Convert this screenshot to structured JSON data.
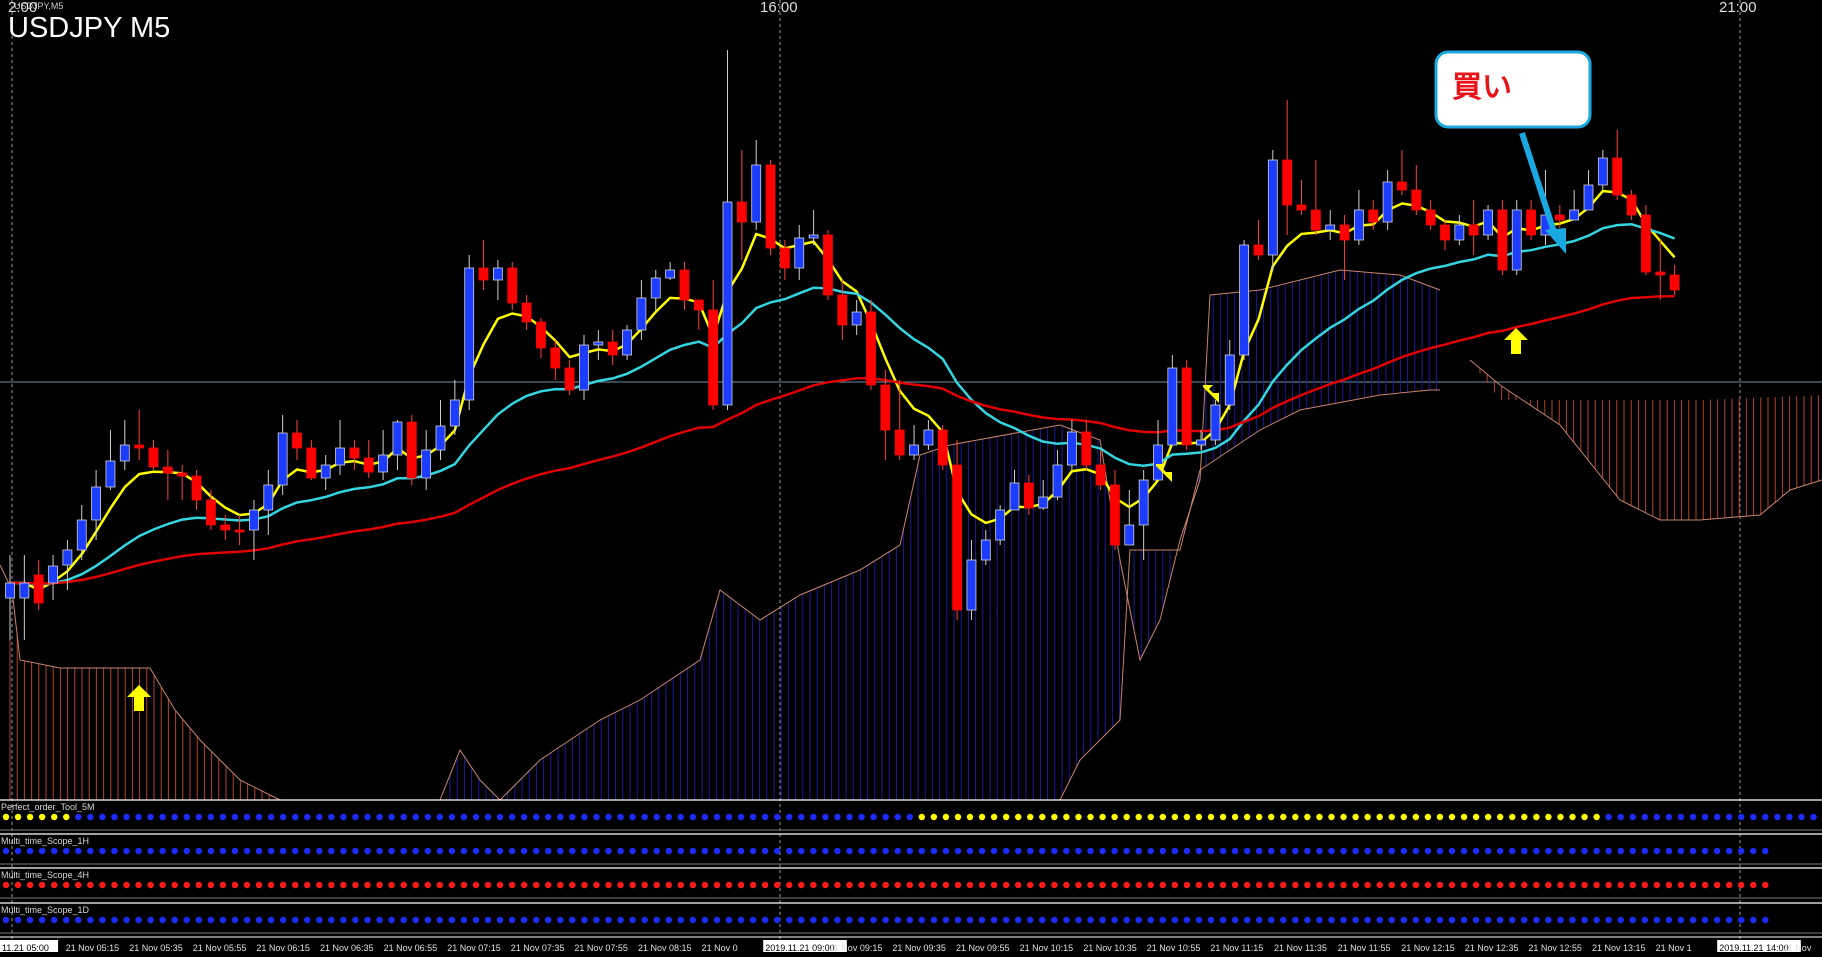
{
  "window": {
    "title": "USDJPY M5",
    "subtitle": "USDJPY,M5"
  },
  "colors": {
    "background": "#000000",
    "bull": "#1c3cff",
    "bear": "#ff0000",
    "ma_fast": "#ffff00",
    "ma_mid": "#33d6e0",
    "ma_slow": "#e00000",
    "cloud_bull": "#1b1b9a",
    "cloud_bear": "#b0452e",
    "dot_yellow": "#ffff00",
    "dot_blue": "#1c2cff",
    "dot_red": "#ff1a1a",
    "arrow_blue": "#1aa8e0"
  },
  "axis": {
    "top_labels": [
      "2:00",
      "16:00",
      "21:00"
    ],
    "x_labels": [
      "11.21 05:00",
      "21 Nov 05:15",
      "21 Nov 05:35",
      "21 Nov 05:55",
      "21 Nov 06:15",
      "21 Nov 06:35",
      "21 Nov 06:55",
      "21 Nov 07:15",
      "21 Nov 07:35",
      "21 Nov 07:55",
      "21 Nov 08:15",
      "21 Nov 0",
      "2019.11.21 09:00",
      "21 Nov 09:15",
      "21 Nov 09:35",
      "21 Nov 09:55",
      "21 Nov 10:15",
      "21 Nov 10:35",
      "21 Nov 10:55",
      "21 Nov 11:15",
      "21 Nov 11:35",
      "21 Nov 11:55",
      "21 Nov 12:15",
      "21 Nov 12:35",
      "21 Nov 12:55",
      "21 Nov 13:15",
      "21 Nov 1",
      "2019.11.21 14:00",
      "21 Nov"
    ]
  },
  "annotation": {
    "label": "買い"
  },
  "indicators": [
    {
      "name": "Perfect_order_Tool_5M",
      "dots": "YYYYYYBBBBBBBBBBBBBBBBBBBBBBBBBBBBBBBBBBBBBBBBBBBBBBBBBBBBBBBBBBBBBBBBBBBBBBYYYYYYYYYYYYYYYYYYYYYYYYYYYYYYYYYYYYYYYYYYYYYYYYYYYYYYYYYBBBBBBBBBBBBBBBBBBBBBBBBB"
    },
    {
      "name": "Multi_time_Scope_1H",
      "dots": "BBBBBBBBBBBBBBBBBBBBBBBBBBBBBBBBBBBBBBBBBBBBBBBBBBBBBBBBBBBBBBBBBBBBBBBBBBBBBBBBBBBBBBBBBBBBBBBBBBBBBBBBBBBBBBBBBBBBBBBBBBBBBBBBBBBBBBBBBBBBBBBBBBB"
    },
    {
      "name": "Multi_time_Scope_4H",
      "dots": "RRRRRRRRRRRRRRRRRRRRRRRRRRRRRRRRRRRRRRRRRRRRRRRRRRRRRRRRRRRRRRRRRRRRRRRRRRRRRRRRRRRRRRRRRRRRRRRRRRRRRRRRRRRRRRRRRRRRRRRRRRRRRRRRRRRRRRRRRRRRRRRRRRR"
    },
    {
      "name": "Multi_time_Scope_1D",
      "dots": "BBBBBBBBBBBBBBBBBBBBBBBBBBBBBBBBBBBBBBBBBBBBBBBBBBBBBBBBBBBBBBBBBBBBBBBBBBBBBBBBBBBBBBBBBBBBBBBBBBBBBBBBBBBBBBBBBBBBBBBBBBBBBBBBBBBBBBBBBBBBBBBBBBB"
    }
  ],
  "chart_data": {
    "type": "candlestick",
    "symbol": "USDJPY",
    "timeframe": "M5",
    "ylim": [
      0,
      800
    ],
    "candles": [
      [
        598,
        583,
        640,
        555
      ],
      [
        598,
        583,
        640,
        555
      ],
      [
        575,
        603,
        610,
        560
      ],
      [
        583,
        566,
        600,
        555
      ],
      [
        565,
        550,
        590,
        540
      ],
      [
        550,
        520,
        560,
        505
      ],
      [
        520,
        487,
        540,
        470
      ],
      [
        487,
        461,
        490,
        430
      ],
      [
        461,
        445,
        470,
        420
      ],
      [
        445,
        448,
        460,
        410
      ],
      [
        448,
        467,
        470,
        440
      ],
      [
        467,
        473,
        500,
        450
      ],
      [
        473,
        476,
        500,
        465
      ],
      [
        476,
        500,
        510,
        470
      ],
      [
        500,
        525,
        530,
        490
      ],
      [
        525,
        530,
        540,
        515
      ],
      [
        530,
        530,
        545,
        515
      ],
      [
        530,
        510,
        560,
        500
      ],
      [
        510,
        485,
        535,
        470
      ],
      [
        485,
        433,
        495,
        415
      ],
      [
        433,
        448,
        460,
        420
      ],
      [
        448,
        478,
        480,
        440
      ],
      [
        478,
        465,
        490,
        455
      ],
      [
        465,
        448,
        475,
        420
      ],
      [
        448,
        458,
        470,
        440
      ],
      [
        458,
        472,
        478,
        440
      ],
      [
        472,
        455,
        480,
        430
      ],
      [
        455,
        422,
        470,
        420
      ],
      [
        422,
        478,
        485,
        415
      ],
      [
        478,
        450,
        490,
        430
      ],
      [
        450,
        426,
        460,
        400
      ],
      [
        426,
        400,
        435,
        380
      ],
      [
        400,
        268,
        410,
        255
      ],
      [
        268,
        280,
        290,
        240
      ],
      [
        280,
        268,
        300,
        260
      ],
      [
        268,
        303,
        310,
        262
      ],
      [
        303,
        322,
        330,
        295
      ],
      [
        322,
        348,
        358,
        318
      ],
      [
        348,
        368,
        380,
        340
      ],
      [
        368,
        390,
        395,
        360
      ],
      [
        390,
        345,
        400,
        335
      ],
      [
        345,
        342,
        360,
        330
      ],
      [
        342,
        355,
        365,
        330
      ],
      [
        355,
        330,
        360,
        325
      ],
      [
        330,
        298,
        340,
        280
      ],
      [
        298,
        278,
        310,
        270
      ],
      [
        278,
        270,
        280,
        262
      ],
      [
        270,
        300,
        310,
        262
      ],
      [
        300,
        310,
        330,
        300
      ],
      [
        310,
        405,
        410,
        280
      ],
      [
        405,
        202,
        410,
        50
      ],
      [
        202,
        222,
        260,
        150
      ],
      [
        222,
        165,
        230,
        140
      ],
      [
        165,
        248,
        255,
        160
      ],
      [
        248,
        268,
        280,
        240
      ],
      [
        268,
        238,
        280,
        225
      ],
      [
        238,
        235,
        245,
        210
      ],
      [
        235,
        295,
        300,
        230
      ],
      [
        295,
        325,
        340,
        280
      ],
      [
        325,
        312,
        335,
        300
      ],
      [
        312,
        385,
        390,
        300
      ],
      [
        385,
        430,
        460,
        370
      ],
      [
        430,
        455,
        460,
        380
      ],
      [
        455,
        445,
        460,
        425
      ],
      [
        445,
        430,
        450,
        420
      ],
      [
        430,
        465,
        470,
        425
      ],
      [
        465,
        610,
        620,
        440
      ],
      [
        610,
        560,
        620,
        540
      ],
      [
        560,
        540,
        565,
        530
      ],
      [
        540,
        510,
        545,
        505
      ],
      [
        510,
        483,
        505,
        470
      ],
      [
        483,
        508,
        515,
        475
      ],
      [
        508,
        497,
        510,
        480
      ],
      [
        497,
        465,
        500,
        450
      ],
      [
        465,
        432,
        470,
        420
      ],
      [
        432,
        465,
        470,
        420
      ],
      [
        465,
        485,
        490,
        450
      ],
      [
        485,
        545,
        550,
        470
      ],
      [
        545,
        525,
        545,
        490
      ],
      [
        525,
        480,
        560,
        470
      ],
      [
        480,
        445,
        455,
        420
      ],
      [
        445,
        368,
        380,
        355
      ],
      [
        368,
        445,
        450,
        360
      ],
      [
        445,
        440,
        450,
        430
      ],
      [
        440,
        405,
        445,
        400
      ],
      [
        405,
        355,
        410,
        340
      ],
      [
        355,
        245,
        360,
        240
      ],
      [
        245,
        255,
        260,
        220
      ],
      [
        255,
        160,
        270,
        150
      ],
      [
        160,
        205,
        235,
        100
      ],
      [
        205,
        210,
        215,
        180
      ],
      [
        210,
        230,
        235,
        160
      ],
      [
        230,
        225,
        240,
        210
      ],
      [
        225,
        240,
        280,
        215
      ],
      [
        240,
        210,
        245,
        190
      ],
      [
        210,
        222,
        230,
        200
      ],
      [
        222,
        182,
        230,
        170
      ],
      [
        182,
        190,
        195,
        150
      ],
      [
        190,
        210,
        215,
        165
      ],
      [
        210,
        225,
        230,
        200
      ],
      [
        225,
        240,
        250,
        220
      ],
      [
        240,
        225,
        245,
        215
      ],
      [
        225,
        235,
        255,
        200
      ],
      [
        235,
        210,
        240,
        205
      ],
      [
        210,
        270,
        275,
        200
      ],
      [
        270,
        210,
        275,
        200
      ],
      [
        210,
        235,
        240,
        200
      ],
      [
        235,
        215,
        245,
        170
      ],
      [
        215,
        220,
        228,
        205
      ],
      [
        220,
        210,
        215,
        190
      ],
      [
        210,
        185,
        200,
        170
      ],
      [
        185,
        158,
        190,
        150
      ],
      [
        158,
        195,
        200,
        130
      ],
      [
        195,
        215,
        220,
        190
      ],
      [
        215,
        272,
        275,
        205
      ],
      [
        272,
        275,
        300,
        240
      ],
      [
        275,
        290,
        295,
        265
      ]
    ]
  }
}
